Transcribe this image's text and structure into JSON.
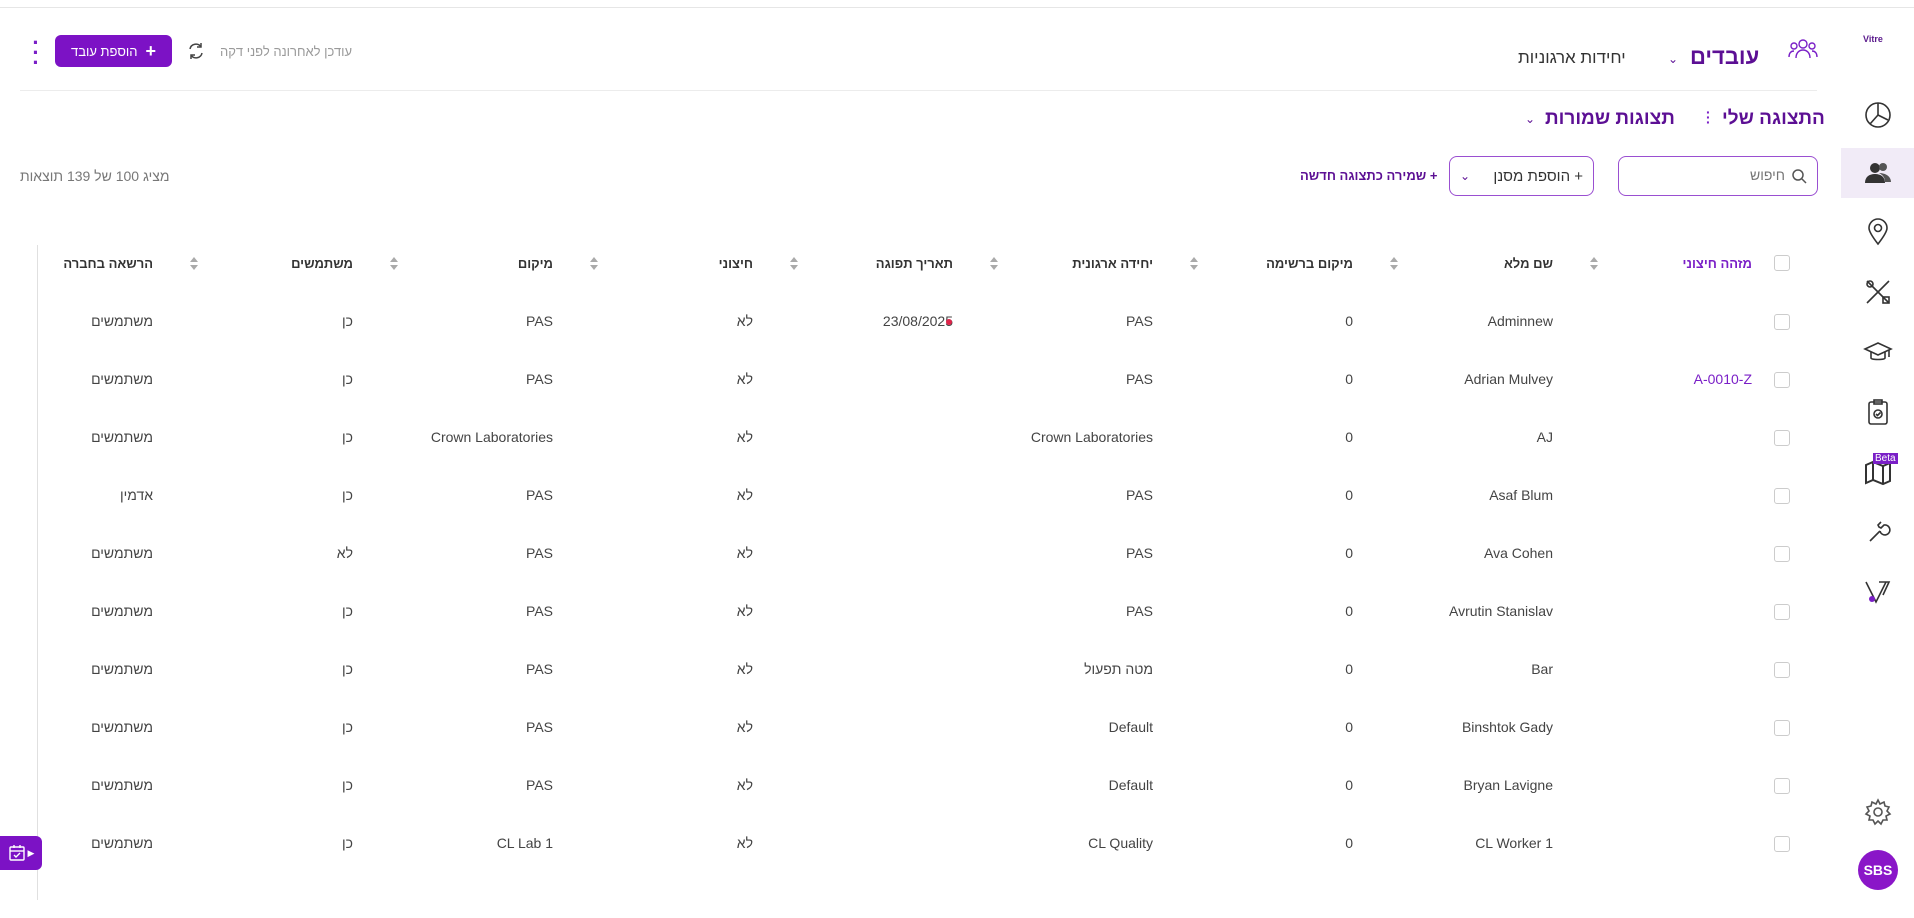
{
  "brand": {
    "logo_text": "Vitre",
    "accent": "#7c12c5",
    "title_color": "#5c0f94"
  },
  "header": {
    "title": "עובדים",
    "units_tab": "יחידות ארגוניות",
    "updated": "עודכן לאחרונה לפני דקה",
    "add_button": "הוספת עובד"
  },
  "views": {
    "my_view": "התצוגה שלי",
    "saved_views": "תצוגות שמורות"
  },
  "toolbar": {
    "search_placeholder": "חיפוש",
    "add_filter": "+ הוספת מסנן",
    "save_new": "+ שמירה כתצוגה חדשה",
    "results": "מציג 100 של 139 תוצאות"
  },
  "columns": {
    "external_id": "מזהה חיצוני",
    "full_name": "שם מלא",
    "list_position": "מיקום ברשימה",
    "org_unit": "יחידה ארגונית",
    "expiry_date": "תאריך תפוגה",
    "external": "חיצוני",
    "location": "מיקום",
    "users": "משתמשים",
    "permission": "הרשאה בחברה"
  },
  "rows": [
    {
      "external_id": "",
      "full_name": "Adminnew",
      "list_position": "0",
      "org_unit": "PAS",
      "expiry_date": "23/08/2025",
      "external": "לא",
      "location": "PAS",
      "users": "כן",
      "permission": "משתמשים"
    },
    {
      "external_id": "A-0010-Z",
      "full_name": "Adrian Mulvey",
      "list_position": "0",
      "org_unit": "PAS",
      "expiry_date": "",
      "external": "לא",
      "location": "PAS",
      "users": "כן",
      "permission": "משתמשים"
    },
    {
      "external_id": "",
      "full_name": "AJ",
      "list_position": "0",
      "org_unit": "Crown Laboratories",
      "expiry_date": "",
      "external": "לא",
      "location": "Crown Laboratories",
      "users": "כן",
      "permission": "משתמשים"
    },
    {
      "external_id": "",
      "full_name": "Asaf Blum",
      "list_position": "0",
      "org_unit": "PAS",
      "expiry_date": "",
      "external": "לא",
      "location": "PAS",
      "users": "כן",
      "permission": "אדמין"
    },
    {
      "external_id": "",
      "full_name": "Ava Cohen",
      "list_position": "0",
      "org_unit": "PAS",
      "expiry_date": "",
      "external": "לא",
      "location": "PAS",
      "users": "לא",
      "permission": "משתמשים"
    },
    {
      "external_id": "",
      "full_name": "Avrutin Stanislav",
      "list_position": "0",
      "org_unit": "PAS",
      "expiry_date": "",
      "external": "לא",
      "location": "PAS",
      "users": "כן",
      "permission": "משתמשים"
    },
    {
      "external_id": "",
      "full_name": "Bar",
      "list_position": "0",
      "org_unit": "מטה תפעול",
      "expiry_date": "",
      "external": "לא",
      "location": "PAS",
      "users": "כן",
      "permission": "משתמשים"
    },
    {
      "external_id": "",
      "full_name": "Binshtok Gady",
      "list_position": "0",
      "org_unit": "Default",
      "expiry_date": "",
      "external": "לא",
      "location": "PAS",
      "users": "כן",
      "permission": "משתמשים"
    },
    {
      "external_id": "",
      "full_name": "Bryan Lavigne",
      "list_position": "0",
      "org_unit": "Default",
      "expiry_date": "",
      "external": "לא",
      "location": "PAS",
      "users": "כן",
      "permission": "משתמשים"
    },
    {
      "external_id": "",
      "full_name": "CL Worker 1",
      "list_position": "0",
      "org_unit": "CL Quality",
      "expiry_date": "",
      "external": "לא",
      "location": "CL Lab 1",
      "users": "כן",
      "permission": "משתמשים"
    }
  ],
  "sidebar": {
    "items": [
      "dashboard-icon",
      "workers-icon",
      "location-icon",
      "tools-icon",
      "training-icon",
      "clipboard-icon",
      "map-beta-icon",
      "wrench-icon",
      "vitre-icon"
    ],
    "beta_label": "Beta",
    "avatar": "SBS"
  }
}
